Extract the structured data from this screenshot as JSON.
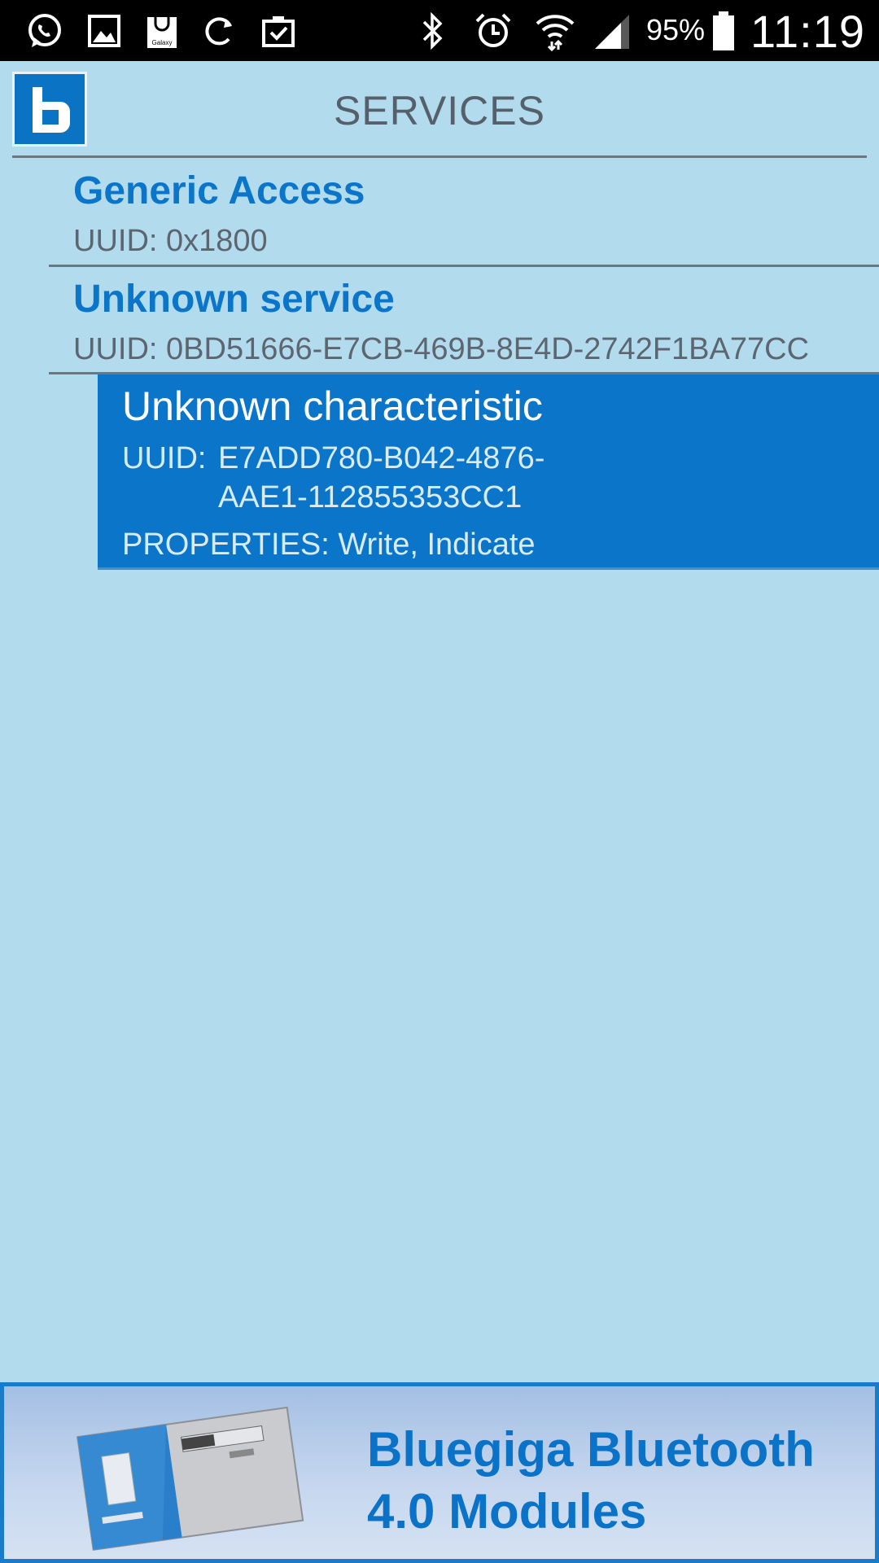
{
  "status_bar": {
    "left_icons": [
      "whatsapp-icon",
      "gallery-icon",
      "galaxy-apps-icon",
      "sync-icon",
      "clipboard-check-icon"
    ],
    "galaxy_label": "Galaxy",
    "right_icons": [
      "bluetooth-icon",
      "alarm-icon",
      "wifi-icon",
      "signal-icon",
      "battery-icon"
    ],
    "battery": "95%",
    "time": "11:19"
  },
  "header": {
    "title": "SERVICES",
    "logo_letter": "b"
  },
  "services": [
    {
      "name": "Generic Access",
      "uuid_label": "UUID:",
      "uuid": "0x1800"
    },
    {
      "name": "Unknown service",
      "uuid_label": "UUID:",
      "uuid": "0BD51666-E7CB-469B-8E4D-2742F1BA77CC"
    }
  ],
  "characteristic": {
    "name": "Unknown characteristic",
    "uuid_label": "UUID:",
    "uuid_line1": "E7ADD780-B042-4876-",
    "uuid_line2": "AAE1-112855353CC1",
    "properties_label": "PROPERTIES:",
    "properties": "Write, Indicate"
  },
  "banner": {
    "line1": "Bluegiga Bluetooth",
    "line2": "4.0 Modules"
  },
  "colors": {
    "background": "#b2dbee",
    "accent": "#0a75c9",
    "muted_text": "#5d6670"
  }
}
